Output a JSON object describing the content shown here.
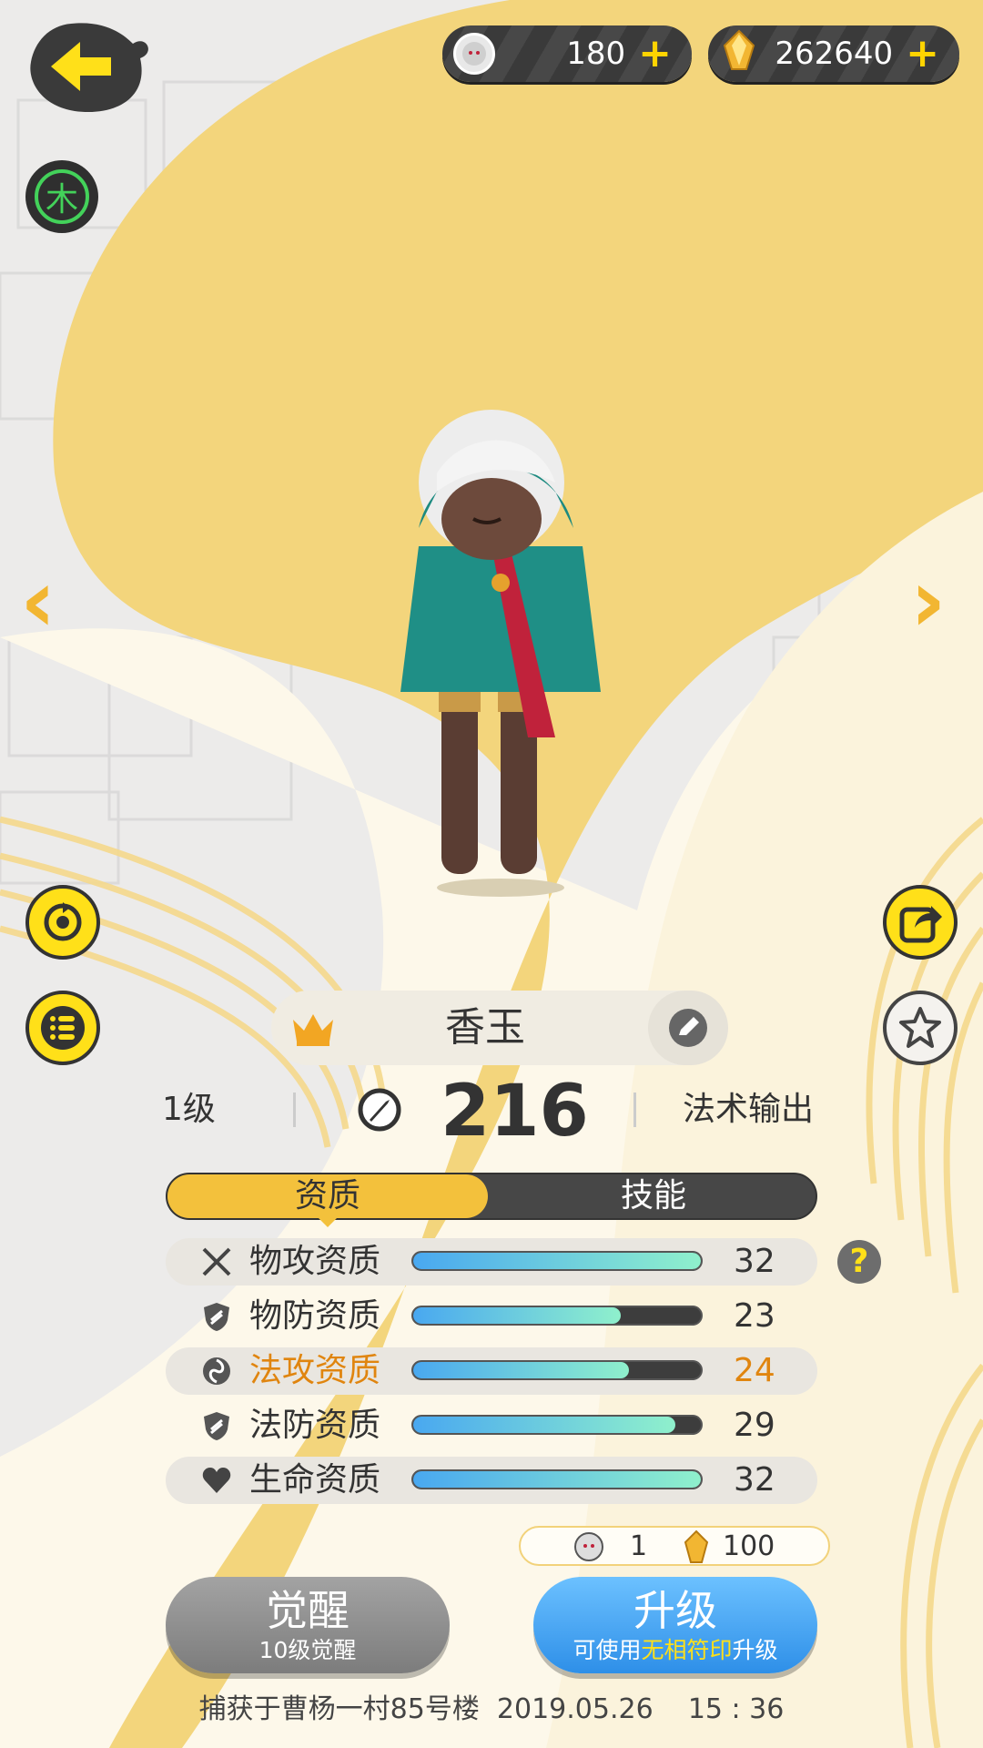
{
  "currency": {
    "soul_count": "180",
    "crystal_count": "262640"
  },
  "element_badge": "木",
  "pet": {
    "name": "香玉",
    "level": "1级",
    "power": "216",
    "role": "法术输出"
  },
  "tabs": {
    "aptitude": "资质",
    "skills": "技能"
  },
  "stats": [
    {
      "icon": "sword-icon",
      "label": "物攻资质",
      "value": "32",
      "fill": 1.0
    },
    {
      "icon": "shield-icon",
      "label": "物防资质",
      "value": "23",
      "fill": 0.72
    },
    {
      "icon": "magic-swirl-icon",
      "label": "法攻资质",
      "value": "24",
      "fill": 0.75
    },
    {
      "icon": "shield-icon",
      "label": "法防资质",
      "value": "29",
      "fill": 0.91
    },
    {
      "icon": "heart-icon",
      "label": "生命资质",
      "value": "32",
      "fill": 1.0
    }
  ],
  "cost": {
    "soul": "1",
    "crystal": "100"
  },
  "buttons": {
    "awaken": "觉醒",
    "awaken_sub": "10级觉醒",
    "upgrade": "升级",
    "upgrade_sub_pre": "可使用",
    "upgrade_sub_item": "无相符印",
    "upgrade_sub_post": "升级"
  },
  "footer": "捕获于曹杨一村85号楼  2019.05.26    15 : 36",
  "colors": {
    "accent_yellow": "#ffe019",
    "tab_active": "#f3c13c",
    "tab_inactive": "#474747",
    "awaken_btn": "#8b8b8b",
    "upgrade_btn": "#3fa0ee",
    "highlight_orange": "#e0850f"
  }
}
